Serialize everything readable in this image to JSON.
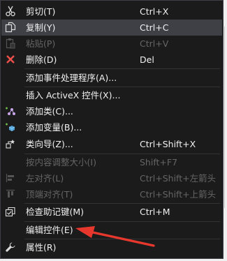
{
  "context_menu": {
    "items": [
      {
        "label": "剪切(T)",
        "shortcut": "Ctrl+X",
        "icon": "scissors-icon",
        "disabled": false
      },
      {
        "label": "复制(Y)",
        "shortcut": "Ctrl+C",
        "icon": "copy-icon",
        "disabled": false
      },
      {
        "label": "粘贴(P)",
        "shortcut": "Ctrl+V",
        "icon": "paste-icon",
        "disabled": true
      },
      {
        "label": "删除(D)",
        "shortcut": "Del",
        "icon": "delete-x-icon",
        "disabled": false
      },
      {
        "label": "添加事件处理程序(A)...",
        "shortcut": "",
        "icon": "",
        "disabled": false
      },
      {
        "label": "插入 ActiveX 控件(X)...",
        "shortcut": "",
        "icon": "",
        "disabled": false
      },
      {
        "label": "添加类(C)...",
        "shortcut": "",
        "icon": "add-class-icon",
        "disabled": false
      },
      {
        "label": "添加变量(B)...",
        "shortcut": "",
        "icon": "add-variable-icon",
        "disabled": false
      },
      {
        "label": "类向导(Z)...",
        "shortcut": "Ctrl+Shift+X",
        "icon": "class-wizard-icon",
        "disabled": false
      },
      {
        "label": "按内容调整大小(I)",
        "shortcut": "Shift+F7",
        "icon": "",
        "disabled": true
      },
      {
        "label": "左对齐(L)",
        "shortcut": "Ctrl+Shift+左箭头",
        "icon": "align-left-icon",
        "disabled": true
      },
      {
        "label": "顶端对齐(T)",
        "shortcut": "Ctrl+Shift+上箭头",
        "icon": "align-top-icon",
        "disabled": true
      },
      {
        "label": "检查助记键(M)",
        "shortcut": "Ctrl+M",
        "icon": "check-mnemonics-icon",
        "disabled": false
      },
      {
        "label": "编辑控件(E)",
        "shortcut": "",
        "icon": "",
        "disabled": false
      },
      {
        "label": "属性(R)",
        "shortcut": "",
        "icon": "wrench-icon",
        "disabled": false
      }
    ]
  },
  "colors": {
    "menu_background": "#1b1b1c",
    "hover_background": "#3f3f46",
    "text": "#f1f1f1",
    "disabled_text": "#656565",
    "annotation_arrow": "#e8382e"
  }
}
